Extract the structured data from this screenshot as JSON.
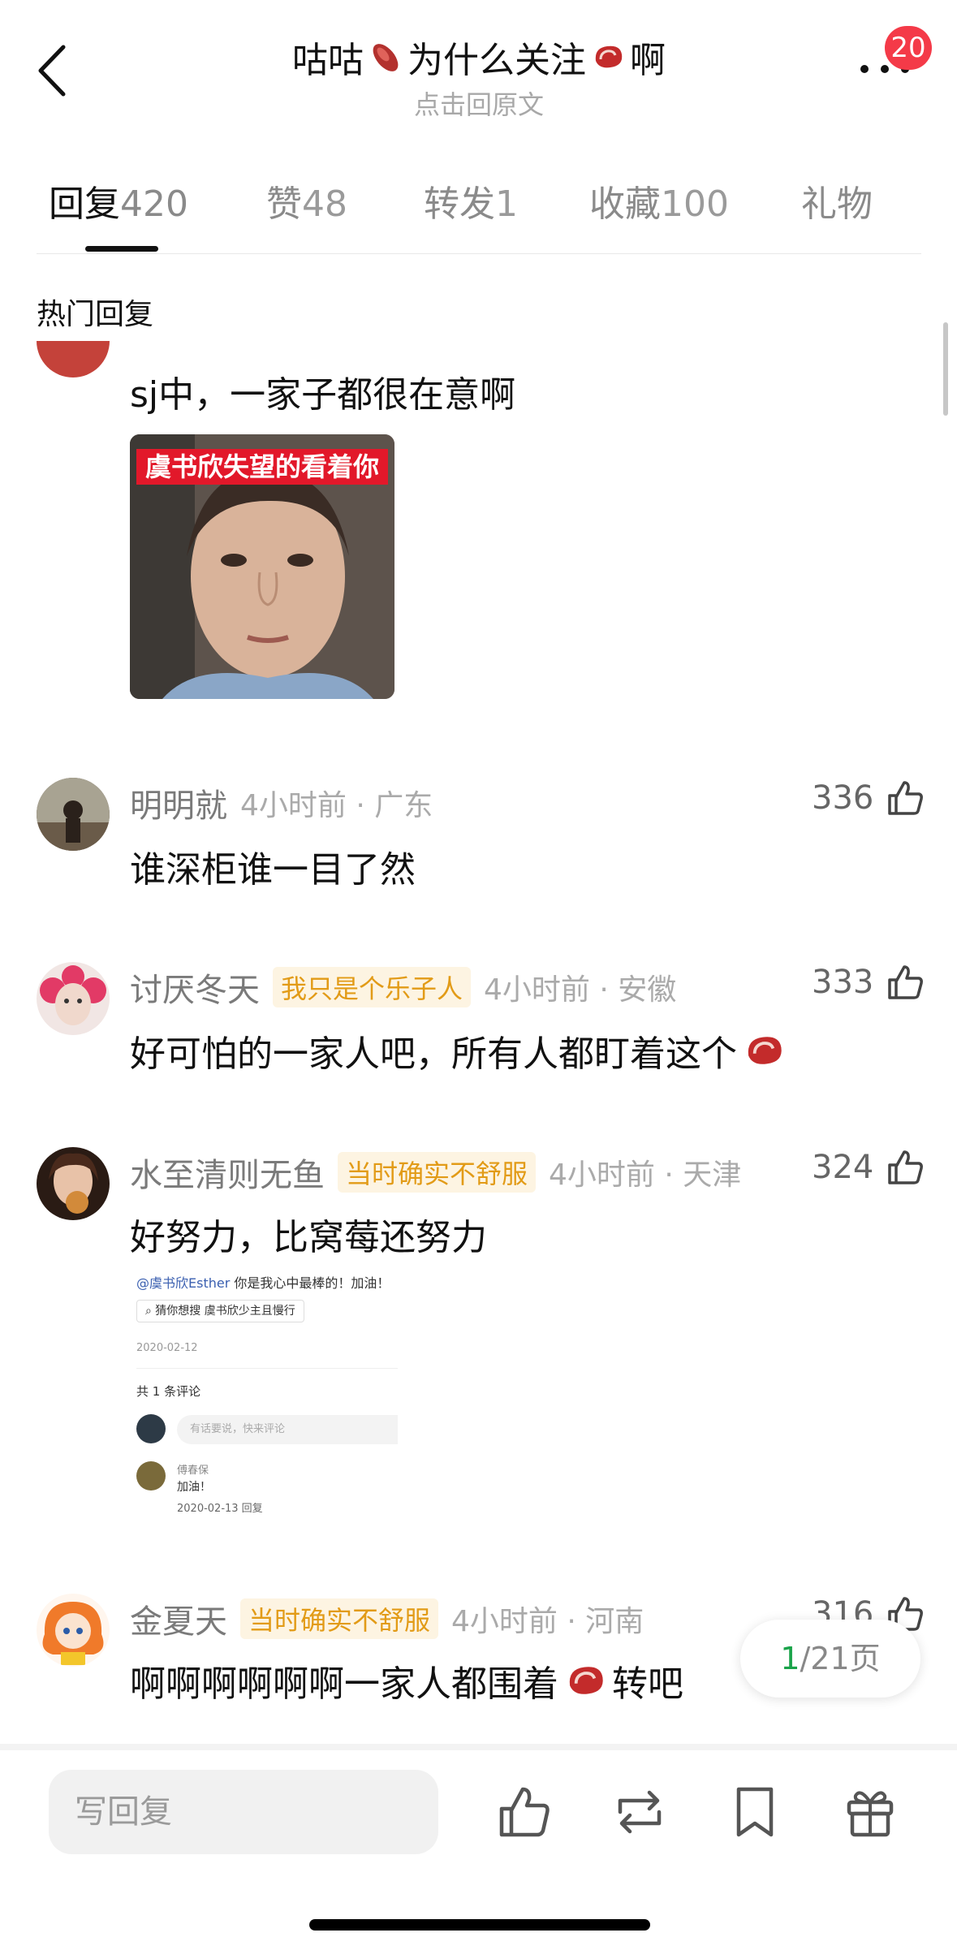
{
  "header": {
    "title_part1": "咕咕",
    "title_part2": "为什么关注",
    "title_part3": "啊",
    "subtitle": "点击回原文",
    "badge_count": "20",
    "icons": [
      "back-chevron-icon",
      "sweet-potato-icon",
      "steak-icon",
      "more-dots-icon"
    ]
  },
  "tabs": [
    {
      "label": "回复",
      "count": "420",
      "active": true
    },
    {
      "label": "赞",
      "count": "48"
    },
    {
      "label": "转发",
      "count": "1"
    },
    {
      "label": "收藏",
      "count": "100"
    },
    {
      "label": "礼物",
      "count": ""
    }
  ],
  "section_title": "热门回复",
  "comments": [
    {
      "text": "sj中，一家子都很在意啊",
      "image_caption": "虞书欣失望的看着你"
    },
    {
      "user": "明明就",
      "meta": "4小时前 · 广东",
      "likes": "336",
      "text": "谁深柜谁一目了然"
    },
    {
      "user": "讨厌冬天",
      "tag": "我只是个乐子人",
      "meta": "4小时前 · 安徽",
      "likes": "333",
      "text": "好可怕的一家人吧，所有人都盯着这个"
    },
    {
      "user": "水至清则无鱼",
      "tag": "当时确实不舒服",
      "meta": "4小时前 · 天津",
      "likes": "324",
      "text": "好努力，比窝莓还努力",
      "embed": {
        "mention": "@虞书欣Esther",
        "line1": " 你是我心中最棒的！加油！",
        "search": "猜你想搜   虞书欣少主且慢行",
        "date": "2020-02-12",
        "count": "共 1 条评论",
        "input_placeholder": "有话要说，快来评论",
        "commenter": "傅春保",
        "comment": "加油！",
        "comment_meta": "2020-02-13   回复"
      }
    },
    {
      "user": "金夏天",
      "tag": "当时确实不舒服",
      "meta": "4小时前 · 河南",
      "likes": "316",
      "text_part1": "啊啊啊啊啊啊一家人都围着",
      "text_part2": "转吧"
    }
  ],
  "pager": {
    "current": "1",
    "total": "/21页"
  },
  "bottom_bar": {
    "reply_placeholder": "写回复",
    "icons": [
      "like-icon",
      "repost-icon",
      "bookmark-icon",
      "gift-icon"
    ]
  },
  "colors": {
    "accent_green": "#1aa34a",
    "badge_red": "#f43a48",
    "tag_orange": "#e29b17"
  }
}
